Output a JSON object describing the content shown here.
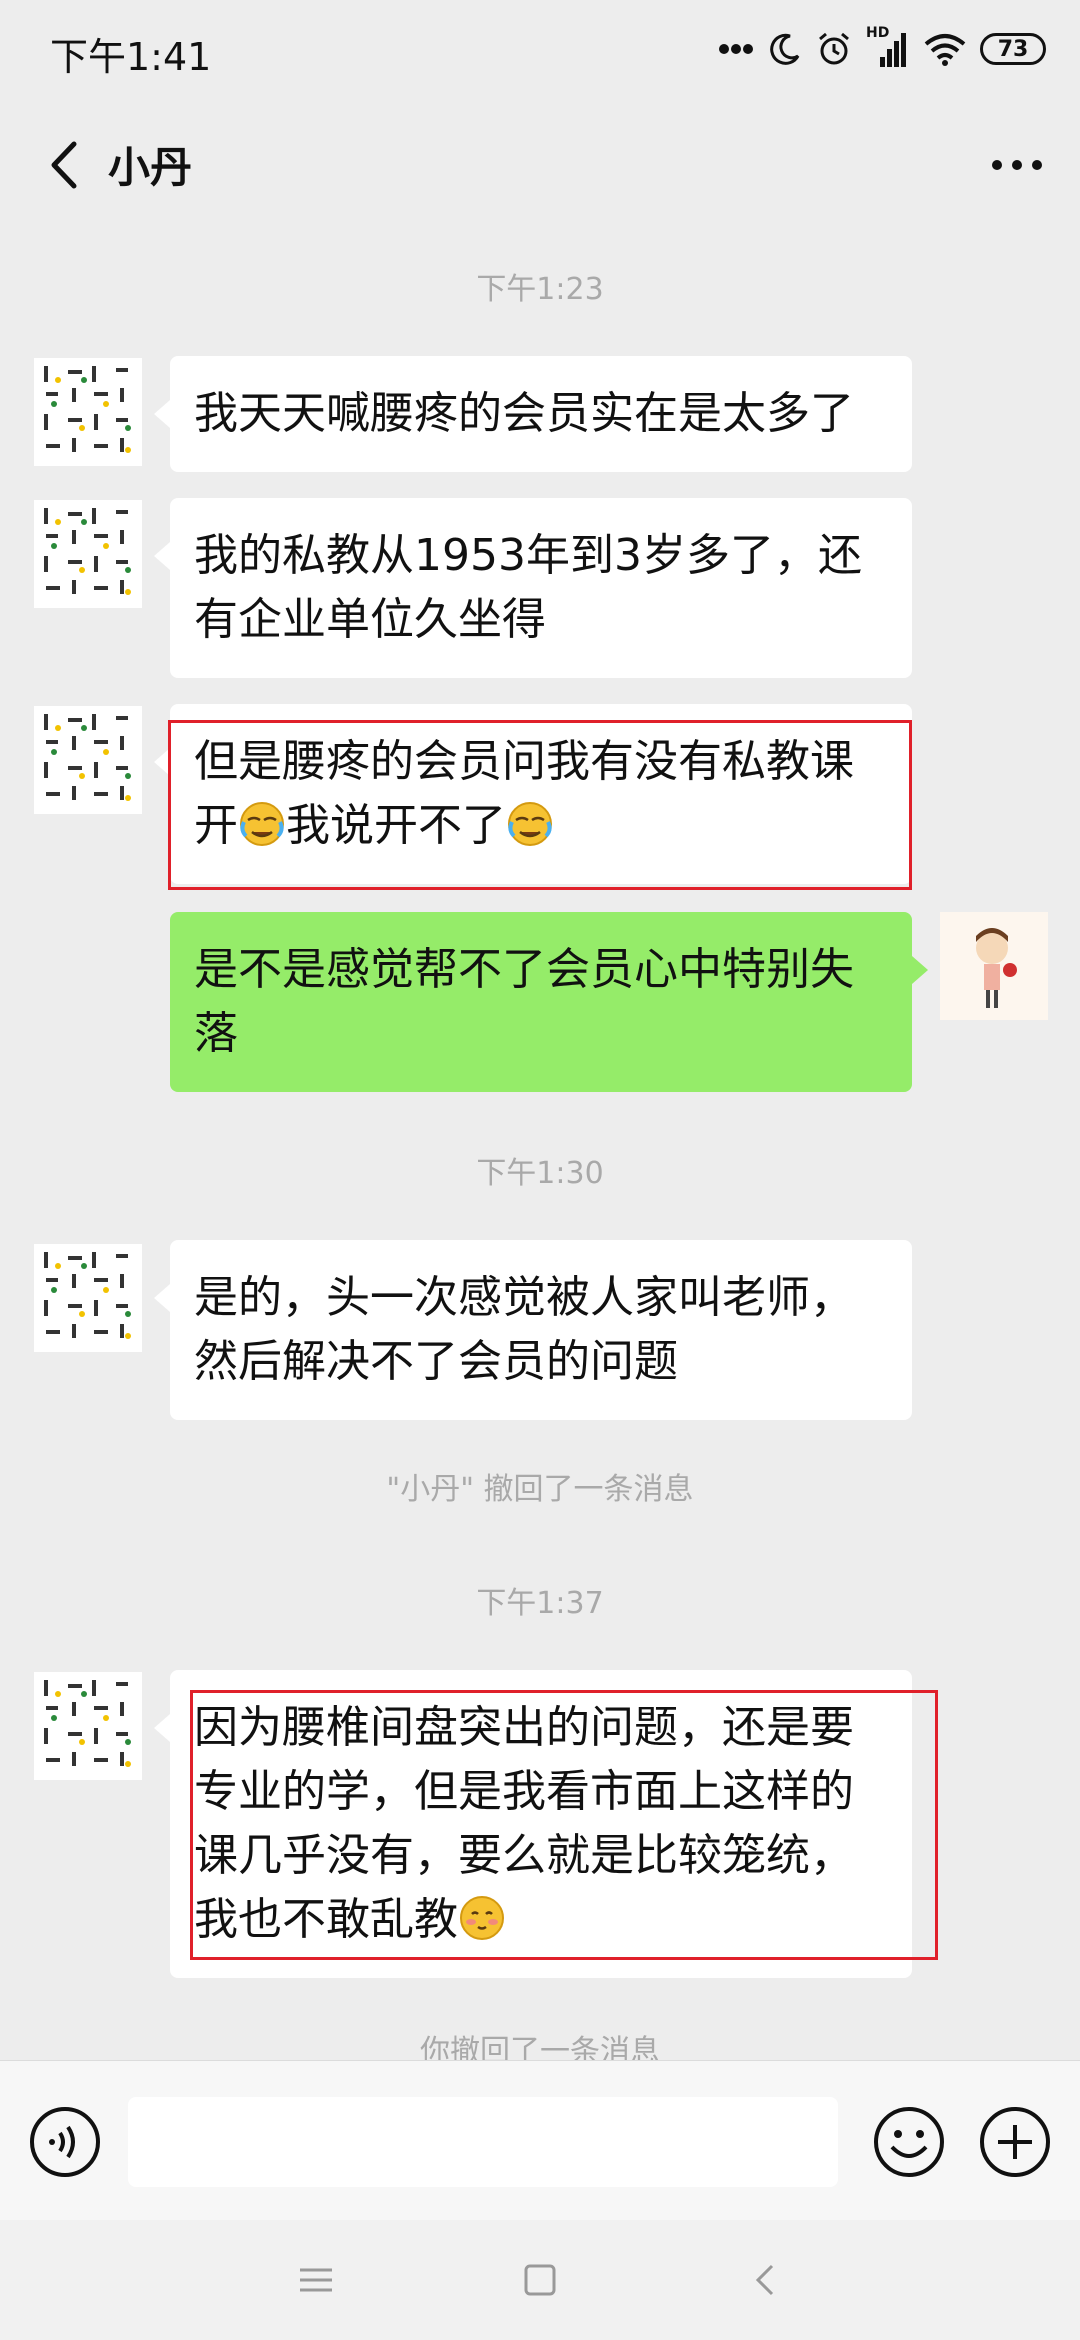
{
  "status_bar": {
    "time": "下午1:41",
    "network": "HD",
    "battery": "73"
  },
  "header": {
    "title": "小丹"
  },
  "messages": [
    {
      "type": "time",
      "text": "下午1:23"
    },
    {
      "type": "left",
      "text": "我天天喊腰疼的会员实在是太多了"
    },
    {
      "type": "left",
      "text": "我的私教从1953年到3岁多了，还有企业单位久坐得"
    },
    {
      "type": "left",
      "line1": "但是腰疼的会员问我有没有私教课",
      "line2a": "开",
      "emoji1": "facepalm-cry-emoji",
      "line2b": "我说开不了",
      "emoji2": "facepalm-cry-emoji",
      "highlighted": true
    },
    {
      "type": "right",
      "text": "是不是感觉帮不了会员心中特别失落"
    },
    {
      "type": "time",
      "text": "下午1:30"
    },
    {
      "type": "left",
      "text": "是的，头一次感觉被人家叫老师，然后解决不了会员的问题"
    },
    {
      "type": "system",
      "text": "\"小丹\" 撤回了一条消息"
    },
    {
      "type": "time",
      "text": "下午1:37"
    },
    {
      "type": "left",
      "text": "因为腰椎间盘突出的问题，还是要专业的学，但是我看市面上这样的课几乎没有，要么就是比较笼统，我也不敢乱教",
      "emoji": "blush-emoji",
      "highlighted": true
    },
    {
      "type": "system",
      "text": "你撤回了一条消息"
    }
  ],
  "colors": {
    "highlight": "#e0202a",
    "bubble_self": "#95ec69",
    "bubble_other": "#ffffff",
    "background": "#ededed"
  }
}
